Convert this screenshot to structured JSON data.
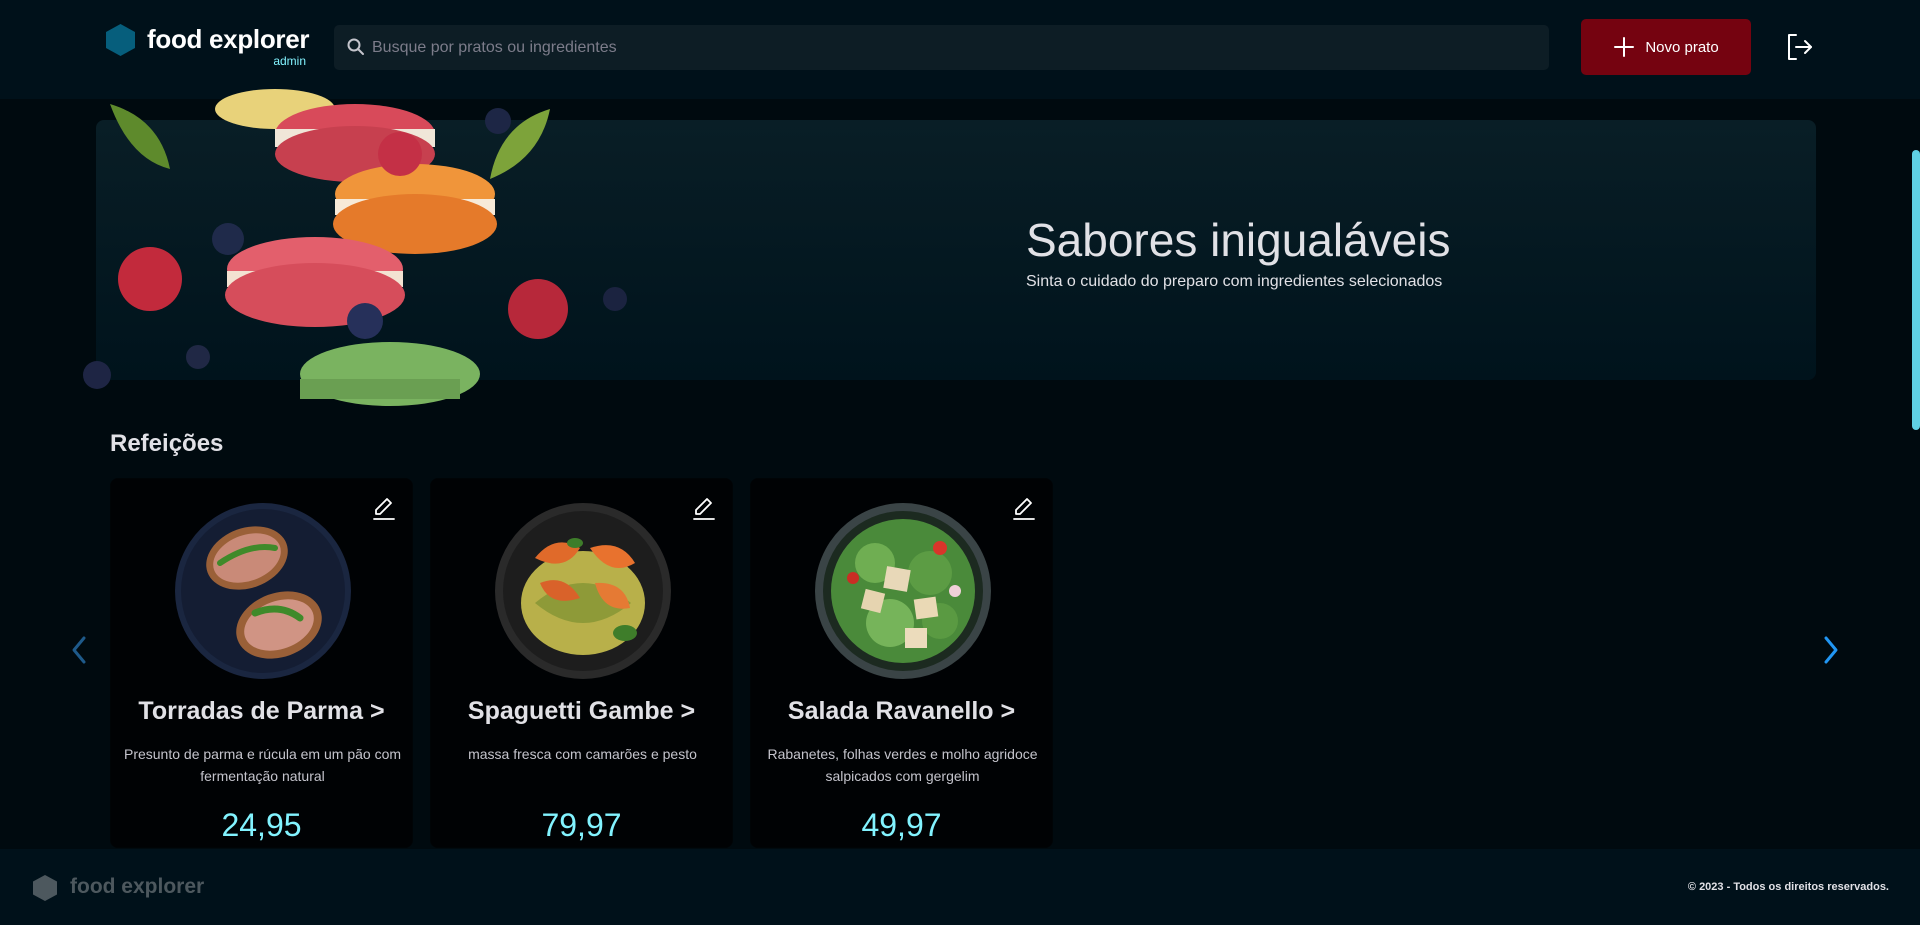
{
  "header": {
    "brand_name": "food explorer",
    "brand_role": "admin",
    "search_placeholder": "Busque por pratos ou ingredientes",
    "new_dish_label": "Novo prato"
  },
  "banner": {
    "title": "Sabores inigualáveis",
    "subtitle": "Sinta o cuidado do preparo com ingredientes selecionados"
  },
  "section": {
    "title": "Refeições"
  },
  "dishes": [
    {
      "name": "Torradas de Parma >",
      "description": "Presunto de parma e rúcula em um pão com fermentação natural",
      "price": "24,95",
      "icon": "toast-dish-image"
    },
    {
      "name": "Spaguetti Gambe >",
      "description": "massa fresca com camarões e pesto",
      "price": "79,97",
      "icon": "shrimp-pasta-image"
    },
    {
      "name": "Salada Ravanello >",
      "description": "Rabanetes, folhas verdes e molho agridoce salpicados com gergelim",
      "price": "49,97",
      "icon": "salad-bowl-image"
    }
  ],
  "footer": {
    "brand_name": "food explorer",
    "copyright": "© 2023 - Todos os direitos reservados."
  },
  "colors": {
    "background": "#000a0f",
    "header": "#00111a",
    "accent_button": "#750310",
    "price": "#82f3ff",
    "brand_hex": "#065e7c",
    "footer_muted": "#4d585e"
  }
}
